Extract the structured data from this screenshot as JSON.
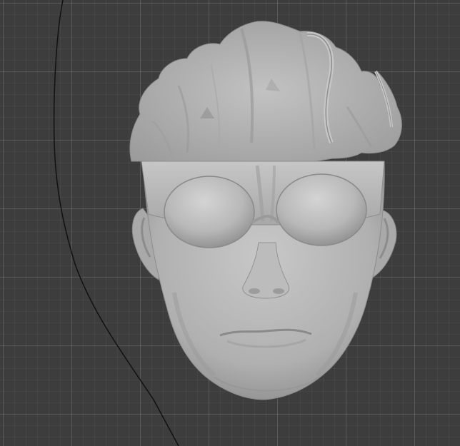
{
  "viewport": {
    "background": "#3d3d3d",
    "grid": true,
    "grid_line_color": "#4a4a4a",
    "grid_major_line_color": "#515151"
  },
  "model": {
    "material_color": "#b4b4b4",
    "shadow_color": "#8a8a8a",
    "highlight_color": "#cfcfcf",
    "parts": [
      "hair",
      "headband",
      "goggles",
      "face",
      "ears",
      "nose",
      "mouth"
    ]
  },
  "curve": {
    "color": "#111111"
  }
}
